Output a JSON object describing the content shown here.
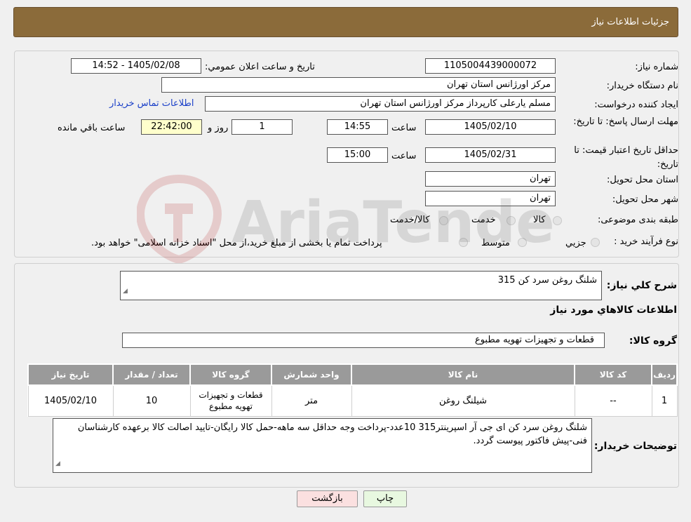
{
  "header": {
    "title": "جزئيات اطلاعات نياز"
  },
  "fields": {
    "need_number_label": "شماره نياز:",
    "need_number": "1105004439000072",
    "announce_label": "تاريخ و ساعت اعلان عمومي:",
    "announce_value": "1405/02/08 - 14:52",
    "buyer_org_label": "نام دستگاه خريدار:",
    "buyer_org": "مرکز اورژانس استان تهران",
    "creator_label": "ايجاد کننده درخواست:",
    "creator": "مسلم يارعلی کارپرداز مرکز اورژانس استان تهران",
    "contact_link": "اطلاعات تماس خريدار",
    "deadline_label": "مهلت ارسال پاسخ: تا تاريخ:",
    "deadline_date": "1405/02/10",
    "time_label": "ساعت",
    "deadline_time": "14:55",
    "days_value": "1",
    "days_label": "روز و",
    "remaining_time": "22:42:00",
    "remaining_label": "ساعت باقي مانده",
    "validity_label": "حداقل تاريخ اعتبار قيمت: تا تاريخ:",
    "validity_date": "1405/02/31",
    "validity_time": "15:00",
    "province_label": "استان محل تحويل:",
    "province": "تهران",
    "city_label": "شهر محل تحويل:",
    "city": "تهران",
    "category_label": "طبقه بندی موضوعی:",
    "category_options": [
      "کالا",
      "خدمت",
      "کالا/خدمت"
    ],
    "process_label": "نوع فرآيند خريد :",
    "process_options": [
      "جزيي",
      "متوسط"
    ],
    "process_note": "پرداخت تمام يا بخشی از مبلغ خريد،از محل \"اسناد خزانه اسلامی\" خواهد بود."
  },
  "summary": {
    "label": "شرح کلي نياز:",
    "value": "شلنگ روغن سرد کن 315",
    "goods_title": "اطلاعات کالاهاي مورد نياز",
    "group_label": "گروه کالا:",
    "group_value": "قطعات و تجهيزات تهويه مطبوع"
  },
  "table": {
    "headers": [
      "رديف",
      "کد کالا",
      "نام کالا",
      "واحد شمارش",
      "گروه کالا",
      "تعداد / مقدار",
      "تاريخ نياز"
    ],
    "rows": [
      [
        "1",
        "--",
        "شيلنگ روغن",
        "متر",
        "قطعات و تجهيزات تهويه مطبوع",
        "10",
        "1405/02/10"
      ]
    ]
  },
  "notes": {
    "label": "توضيحات خريدار:",
    "value": "شلنگ روغن سرد کن ای جی آر اسپرينتر315    10عدد-پرداخت وجه حداقل سه ماهه-حمل کالا رايگان-تاييد اصالت کالا برعهده کارشناسان فنی-پيش فاکتور پيوست گردد."
  },
  "buttons": {
    "print": "چاپ",
    "back": "بازگشت"
  },
  "watermark": {
    "text": "AriaTender.neT"
  }
}
